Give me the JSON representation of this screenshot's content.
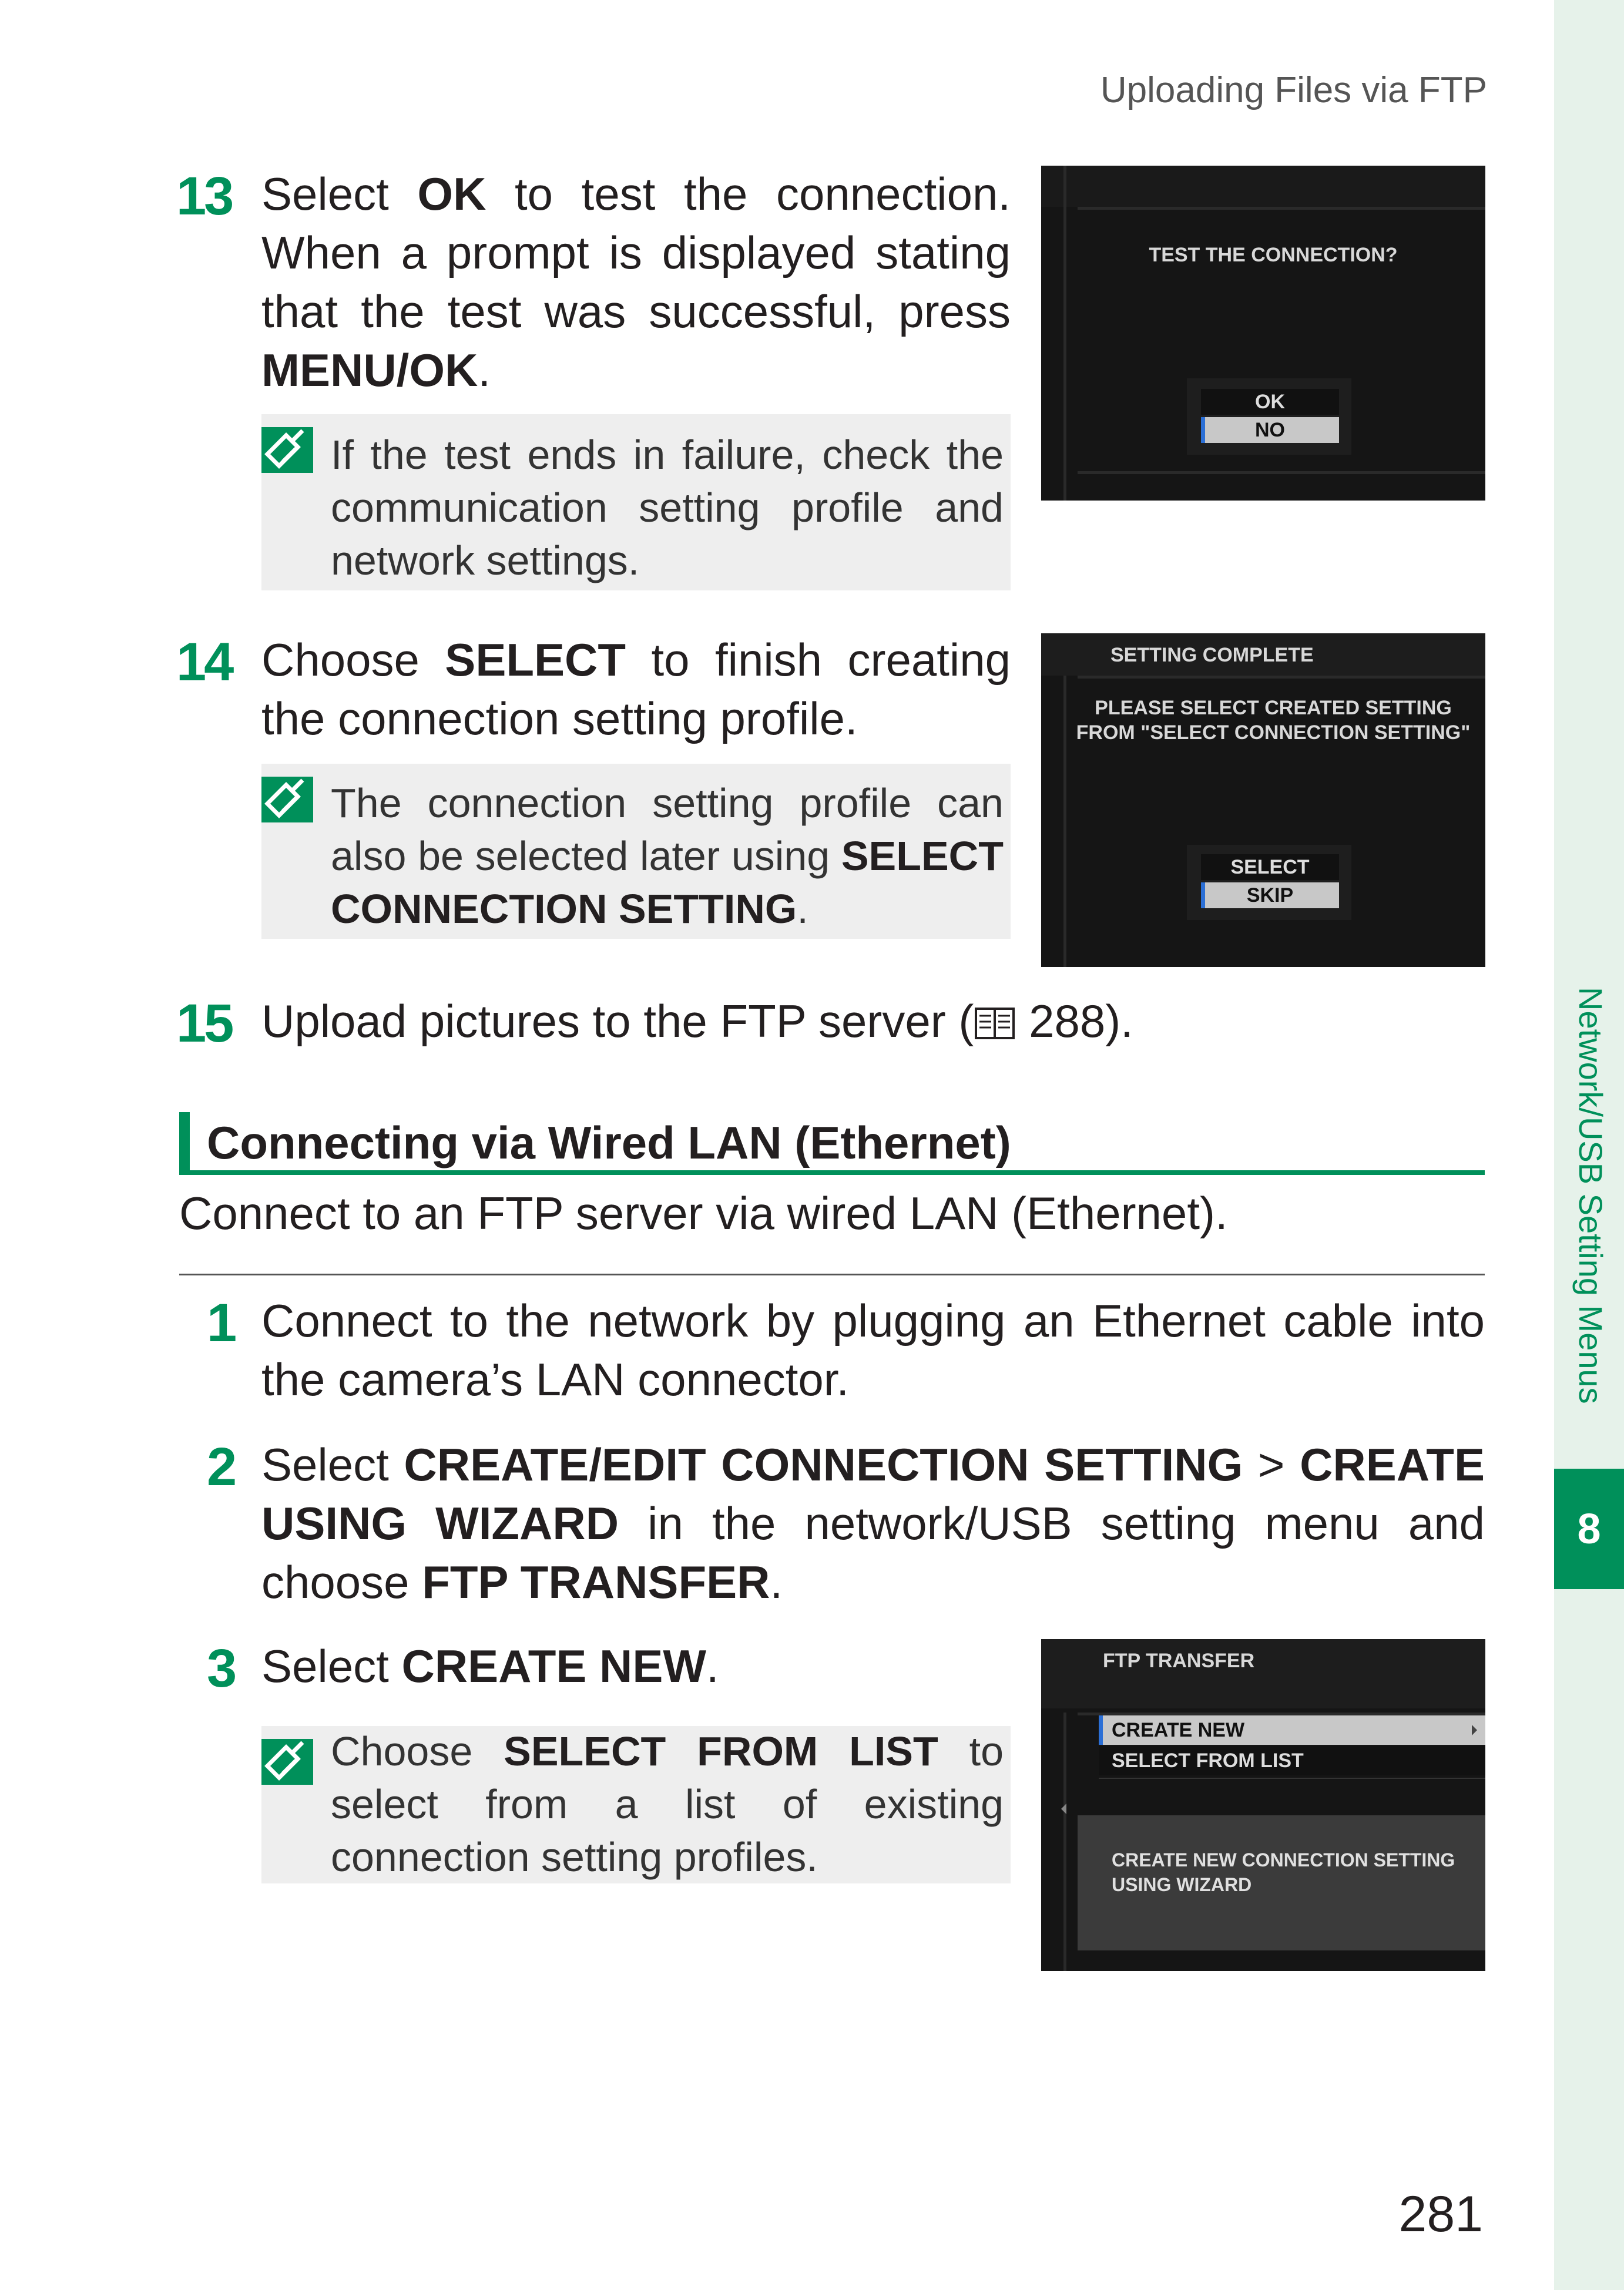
{
  "header": "Uploading Files via FTP",
  "sidebar": {
    "section": "Network/USB Setting Menus",
    "chapter": "8"
  },
  "steps": {
    "s13": {
      "num": "13",
      "t1": "Select ",
      "b1": "OK",
      "t2": " to test the connection. When a prompt is displayed stating that the test was successful, press ",
      "b2": "MENU/OK",
      "t3": "."
    },
    "s14": {
      "num": "14",
      "t1": "Choose ",
      "b1": "SELECT",
      "t2": " to finish creating the connection setting profile."
    },
    "s15": {
      "num": "15",
      "t1": "Upload pictures to the FTP server (",
      "ref": "288",
      "t2": ")."
    },
    "s1": {
      "num": "1",
      "text": "Connect to the network by plugging an Ethernet cable into the camera’s LAN connector."
    },
    "s2": {
      "num": "2",
      "t1": "Select ",
      "b1": "CREATE/EDIT CONNECTION SETTING",
      "t2": " > ",
      "b2": "CREATE USING WIZARD",
      "t3": " in the network/USB setting menu and choose ",
      "b3": "FTP TRANSFER",
      "t4": "."
    },
    "s3": {
      "num": "3",
      "t1": "Select ",
      "b1": "CREATE NEW",
      "t2": "."
    }
  },
  "notes": {
    "n13": {
      "text": "If the test ends in failure, check the communication setting profile and network settings."
    },
    "n14": {
      "t1": "The connection setting profile can also be selected later using ",
      "b1": "SELECT CONNECTION SETTING",
      "t2": "."
    },
    "n3": {
      "t1": "Choose ",
      "b1": "SELECT FROM LIST",
      "t2": " to select from a list of existing connection setting profiles."
    }
  },
  "section": {
    "title": "Connecting via Wired LAN (Ethernet)",
    "intro": "Connect to an FTP server via wired LAN (Ethernet)."
  },
  "screens": {
    "test": {
      "title": "TEST THE CONNECTION?",
      "opt1": "OK",
      "opt2": "NO"
    },
    "complete": {
      "header": "SETTING COMPLETE",
      "line1": "PLEASE SELECT CREATED SETTING",
      "line2": "FROM \"SELECT CONNECTION SETTING\"",
      "opt1": "SELECT",
      "opt2": "SKIP"
    },
    "ftp": {
      "header": "FTP TRANSFER",
      "item1": "CREATE NEW",
      "item2": "SELECT FROM LIST",
      "help1": "CREATE NEW CONNECTION SETTING",
      "help2": "USING WIZARD"
    }
  },
  "page_number": "281",
  "colors": {
    "accent": "#00905a",
    "note_bg": "#eeeeee",
    "tab_bg": "#e6f2ea"
  }
}
